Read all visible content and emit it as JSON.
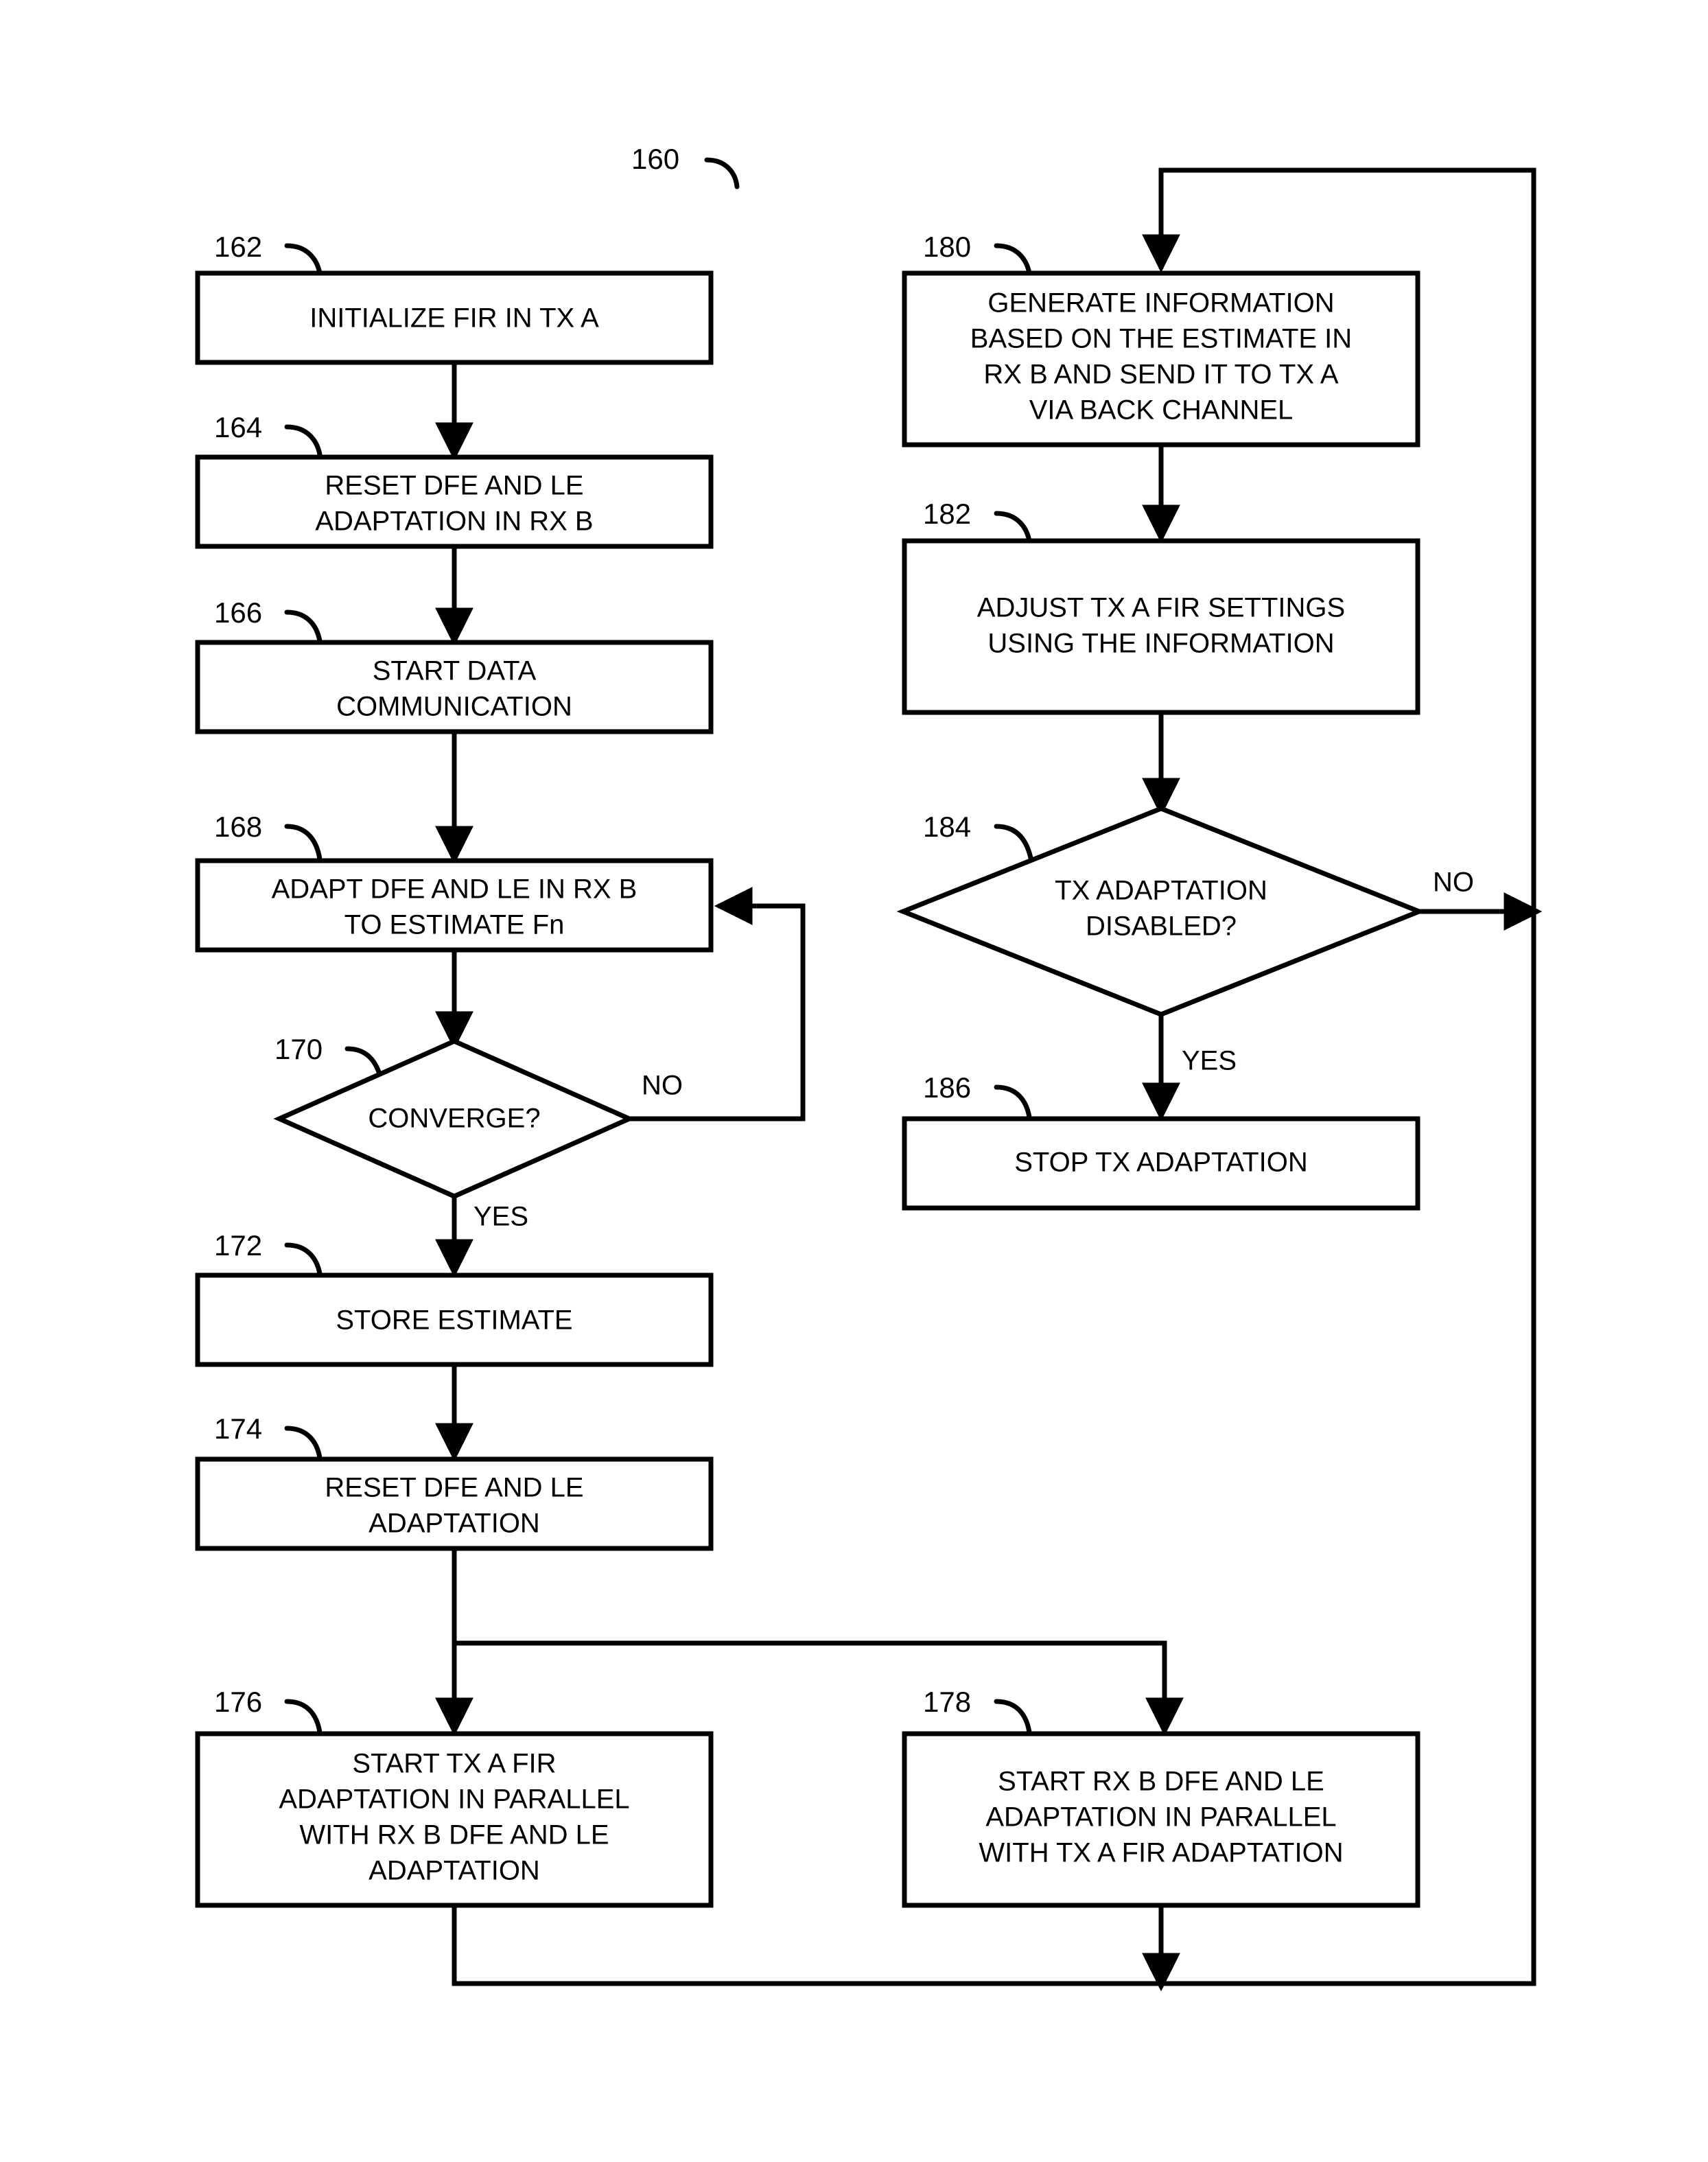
{
  "figure": {
    "label": "160",
    "type": "flowchart"
  },
  "nodes": [
    {
      "ref": "162",
      "shape": "process",
      "lines": [
        "INITIALIZE FIR IN TX A"
      ]
    },
    {
      "ref": "164",
      "shape": "process",
      "lines": [
        "RESET DFE AND LE",
        "ADAPTATION IN RX B"
      ]
    },
    {
      "ref": "166",
      "shape": "process",
      "lines": [
        "START DATA",
        "COMMUNICATION"
      ]
    },
    {
      "ref": "168",
      "shape": "process",
      "lines": [
        "ADAPT DFE AND LE IN RX B",
        "TO ESTIMATE Fn"
      ]
    },
    {
      "ref": "170",
      "shape": "decision",
      "lines": [
        "CONVERGE?"
      ]
    },
    {
      "ref": "172",
      "shape": "process",
      "lines": [
        "STORE ESTIMATE"
      ]
    },
    {
      "ref": "174",
      "shape": "process",
      "lines": [
        "RESET DFE AND LE",
        "ADAPTATION"
      ]
    },
    {
      "ref": "176",
      "shape": "process",
      "lines": [
        "START TX A FIR",
        "ADAPTATION IN PARALLEL",
        "WITH RX B DFE AND LE",
        "ADAPTATION"
      ]
    },
    {
      "ref": "178",
      "shape": "process",
      "lines": [
        "START RX B DFE AND LE",
        "ADAPTATION IN PARALLEL",
        "WITH TX A FIR ADAPTATION"
      ]
    },
    {
      "ref": "180",
      "shape": "process",
      "lines": [
        "GENERATE INFORMATION",
        "BASED ON THE ESTIMATE IN",
        "RX B AND SEND IT TO TX A",
        "VIA BACK CHANNEL"
      ]
    },
    {
      "ref": "182",
      "shape": "process",
      "lines": [
        "ADJUST TX A FIR SETTINGS",
        "USING THE INFORMATION"
      ]
    },
    {
      "ref": "184",
      "shape": "decision",
      "lines": [
        "TX ADAPTATION",
        "DISABLED?"
      ]
    },
    {
      "ref": "186",
      "shape": "process",
      "lines": [
        "STOP TX ADAPTATION"
      ]
    }
  ],
  "edge_labels": {
    "converge_no": "NO",
    "converge_yes": "YES",
    "tx_disabled_no": "NO",
    "tx_disabled_yes": "YES"
  },
  "colors": {
    "ink": "#000000",
    "paper": "#ffffff"
  }
}
